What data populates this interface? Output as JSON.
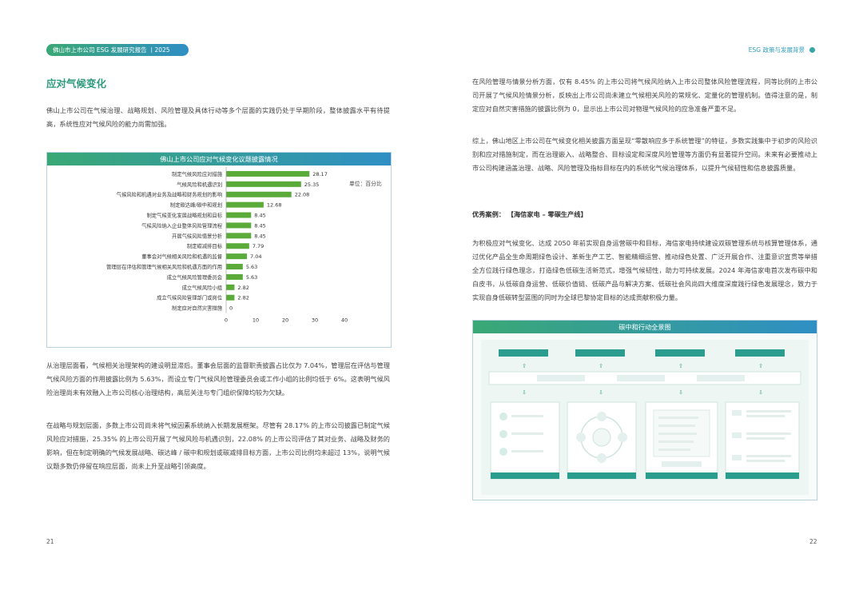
{
  "header": {
    "left_label": "佛山市上市公司 ESG 发展研究报告 丨2025",
    "right_label": "ESG 政策与发展背景",
    "accent_green": "#3aa875",
    "accent_blue": "#2f8fc4"
  },
  "left_page": {
    "title": "应对气候变化",
    "intro": "佛山上市公司在气候治理、战略规划、风险管理及具体行动等多个层面的实践仍处于早期阶段，整体披露水平有待提高，系统性应对气候风险的能力尚需加强。",
    "para_governance": "从治理层面看，气候相关治理架构的建设明显滞后。董事会层面的监督职责披露占比仅为 7.04%，管理层在评估与管理气候风险方面的作用披露比例为 5.63%，而设立专门气候风险管理委员会或工作小组的比例均低于 6%。这表明气候风险治理尚未有效融入上市公司核心治理结构，高层关注与专门组织保障均较为欠缺。",
    "para_strategy": "在战略与规划层面，多数上市公司尚未将气候因素系统纳入长期发展框架。尽管有 28.17% 的上市公司披露已制定气候风险应对措施，25.35% 的上市公司开展了气候风险与机遇识别，22.08% 的上市公司评估了其对业务、战略及财务的影响，但在制定明确的气候发展战略、碳达峰 / 碳中和规划或碳减排目标方面，上市公司比例均未超过 13%，说明气候议题多数仍停留在响应层面，尚未上升至战略引领高度。",
    "page_number": "21"
  },
  "right_page": {
    "para_risk": "在风险管理与情景分析方面，仅有 8.45% 的上市公司将气候风险纳入上市公司整体风险管理流程，同等比例的上市公司开展了气候风险情景分析，反映出上市公司尚未建立气候相关风险的常规化、定量化的管理机制。值得注意的是，制定应对自然灾害措施的披露比例为 0，显示出上市公司对物理气候风险的应急准备严重不足。",
    "para_summary": "综上，佛山地区上市公司在气候变化相关披露方面呈现“零散响应多于系统管理”的特征，多数实践集中于初步的风险识别和应对措施制定，而在治理嵌入、战略整合、目标设定和深度风险管理等方面仍有显著提升空间。未来有必要推动上市公司构建涵盖治理、战略、风险管理及指标目标在内的系统化气候治理体系，以提升气候韧性和信息披露质量。",
    "case_title": "优秀案例： 【海信家电 – 零碳生产线】",
    "para_case": "为积极应对气候变化、达成 2050 年前实现自身运营碳中和目标，海信家电持续建设双碳管理系统与核算管理体系，通过优化产品全生命周期绿色设计、革新生产工艺、智能精细运营、推动绿色处置、广泛开展合作、注重意识宣贯等举措全方位践行绿色理念，打造绿色低碳生活新范式，增强气候韧性，助力可持续发展。2024 年海信家电首次发布碳中和白皮书，从低碳自身运营、低碳价值链、低碳产品与解决方案、低碳社会风尚四大维度深度践行绿色发展理念，致力于实现自身低碳转型蓝图的同时为全球巴黎协定目标的达成贡献积极力量。",
    "diagram_title": "碳中和行动全景图",
    "page_number": "22"
  },
  "chart_data": {
    "type": "bar",
    "orientation": "horizontal",
    "title": "佛山上市公司应对气候变化议题披露情况",
    "unit_label": "单位：百分比",
    "categories": [
      "制定气候风险应对措施",
      "气候风险和机遇识别",
      "气候风险和机遇对业务及战略和财务规划的影响",
      "制定碳达峰/碳中和规划",
      "制定气候变化发展战略规划和目标",
      "气候风险纳入企业整体风险管理流程",
      "开展气候风险情景分析",
      "制定碳减排目标",
      "董事会对气候相关风险和机遇的监督",
      "管理层在评估和管理气候相关风险和机遇方面的作用",
      "成立气候风险管理委员会",
      "成立气候风险小组",
      "成立气候风险管理部门或岗位",
      "制定应对自然灾害措施"
    ],
    "values": [
      28.17,
      25.35,
      22.08,
      12.68,
      8.45,
      8.45,
      8.45,
      7.79,
      7.04,
      5.63,
      5.63,
      2.82,
      2.82,
      0
    ],
    "value_labels": [
      "28.17",
      "25.35",
      "22.08",
      "12.68",
      "8.45",
      "8.45",
      "8.45",
      "7.79",
      "7.04",
      "5.63",
      "5.63",
      "2.82",
      "2.82",
      "0"
    ],
    "xlim": [
      0,
      40
    ],
    "ticks": [
      "0",
      "10",
      "20",
      "30",
      "40"
    ],
    "bar_color": "#5aab3a",
    "grid": false,
    "legend": "none"
  }
}
